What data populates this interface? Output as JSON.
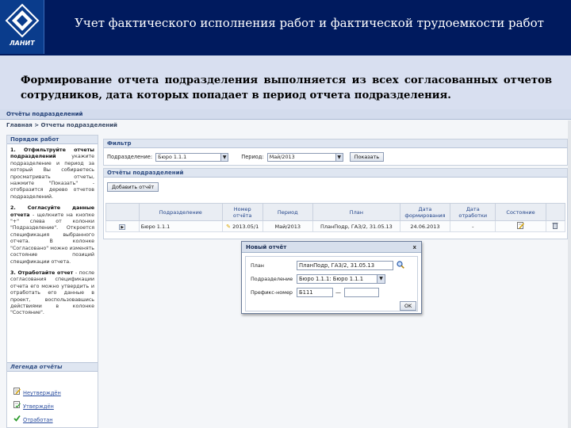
{
  "slide": {
    "title": "Учет фактического исполнения работ и фактической трудоемкости работ",
    "logo_text": "ЛАНИТ",
    "description": "Формирование отчета подразделения выполняется из всех согласованных отчетов сотрудников, дата которых попадает в период отчета подразделения."
  },
  "app": {
    "window_title": "Отчёты подразделений",
    "breadcrumb": {
      "home": "Главная",
      "separator": ">",
      "current": "Отчеты подразделений"
    },
    "left_panel": {
      "title": "Порядок работ",
      "steps": [
        {
          "head": "1. Отфильтруйте отчеты подразделений",
          "body": "укажите подразделение и период за который Вы собираетесь просматривать отчеты, нажмите \"Показать\" - отобразится дерево отчетов подразделений."
        },
        {
          "head": "2. Согласуйте данные отчета",
          "body": "- щелкните на кнопке \"+\" слева от колонки \"Подразделение\". Откроется спецификация выбранного отчета. В колонке \"Согласовано\" можно изменять состояние позиций спецификации отчета."
        },
        {
          "head": "3. Отработайте отчет",
          "body": "- после согласования спецификации отчета его можно утвердить и отработать его данные в проект, воспользовавшись действиями в колонке \"Состояние\"."
        }
      ],
      "legend_title": "Легенда отчёты",
      "legend": [
        {
          "label": "Неутверждён",
          "icon": "edit-icon"
        },
        {
          "label": "Утверждён",
          "icon": "approved-icon"
        },
        {
          "label": "Отработан",
          "icon": "checkmark-icon"
        }
      ]
    },
    "filter": {
      "title": "Фильтр",
      "unit_label": "Подразделение:",
      "unit_value": "Бюро 1.1.1",
      "period_label": "Период:",
      "period_value": "Май/2013",
      "show_button": "Показать"
    },
    "reports": {
      "title": "Отчёты подразделений",
      "add_button": "Добавить отчёт",
      "columns": [
        "Подразделение",
        "Номер отчёта",
        "Период",
        "План",
        "Дата формирования",
        "Дата отработки",
        "Состояние"
      ],
      "rows": [
        {
          "unit": "Бюро 1.1.1",
          "number": "2013.05/1",
          "period": "Май/2013",
          "plan": "ПланПодр, ГАЗ/2, 31.05.13",
          "created": "24.06.2013",
          "processed": "-"
        }
      ]
    },
    "dialog": {
      "title": "Новый отчёт",
      "close": "x",
      "plan_label": "План",
      "plan_value": "ПланПодр, ГАЗ/2, 31.05.13",
      "unit_label": "Подразделение",
      "unit_value": "Бюро 1.1.1: Бюро 1.1.1",
      "prefix_label": "Префикс-номер",
      "prefix_value": "Б111",
      "dash": "—",
      "number_value": "",
      "ok_button": "OK"
    }
  }
}
